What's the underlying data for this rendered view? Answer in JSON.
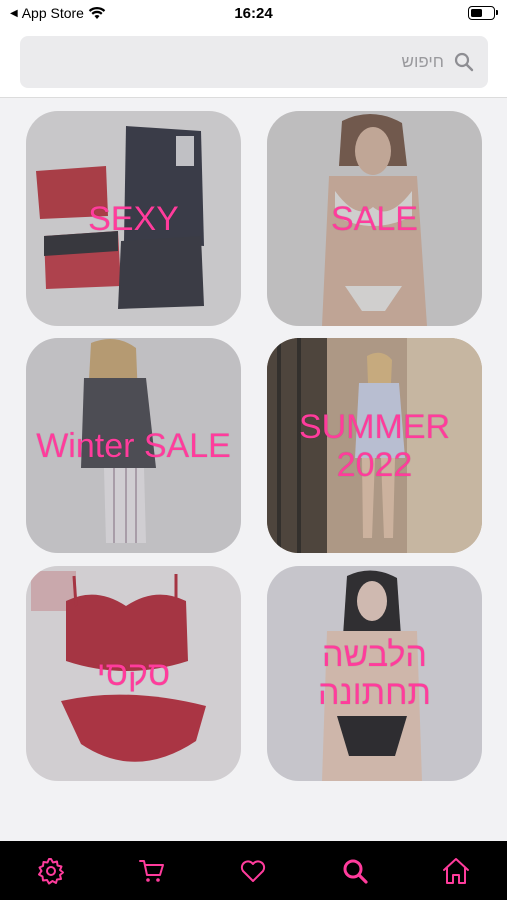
{
  "status_bar": {
    "back_app": "App Store",
    "time": "16:24",
    "battery_level": 0.55
  },
  "search": {
    "placeholder": "חיפוש",
    "value": ""
  },
  "categories": [
    {
      "label": "SEXY",
      "lang": "ltr"
    },
    {
      "label": "SALE",
      "lang": "ltr"
    },
    {
      "label": "Winter SALE",
      "lang": "ltr"
    },
    {
      "label": "SUMMER 2022",
      "lang": "ltr"
    },
    {
      "label": "סקסי",
      "lang": "rtl"
    },
    {
      "label": "הלבשה תחתונה",
      "lang": "rtl"
    }
  ],
  "tabbar": {
    "items": [
      {
        "name": "settings",
        "icon": "gear-icon"
      },
      {
        "name": "cart",
        "icon": "cart-icon"
      },
      {
        "name": "favorites",
        "icon": "heart-icon"
      },
      {
        "name": "search",
        "icon": "search-icon",
        "active": true
      },
      {
        "name": "home",
        "icon": "home-icon"
      }
    ],
    "accent": "#ff3c9c",
    "background": "#000000"
  },
  "colors": {
    "label_pink": "#ff3c9c"
  }
}
